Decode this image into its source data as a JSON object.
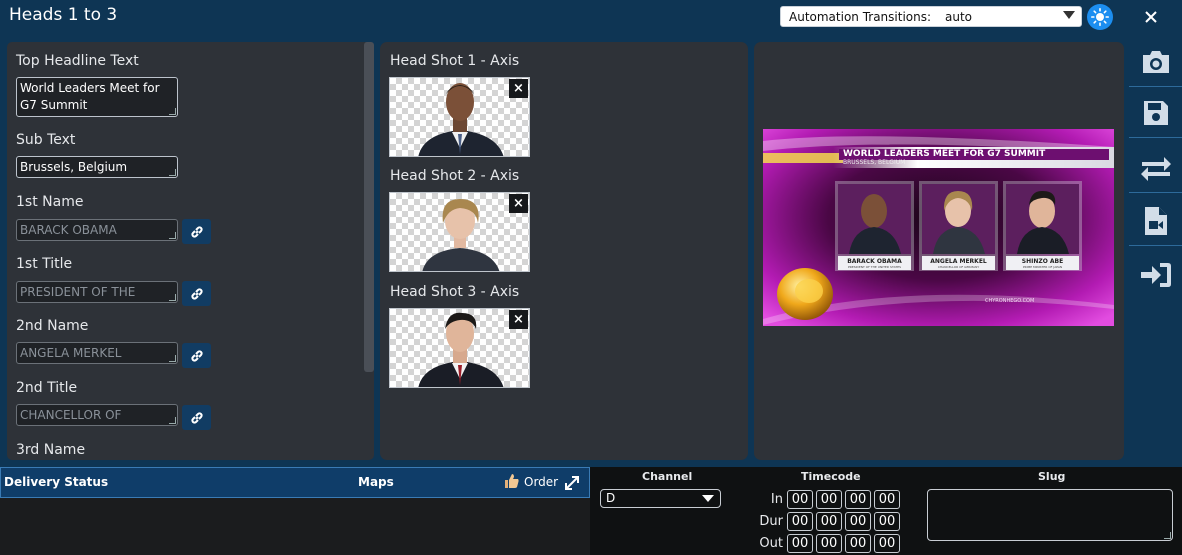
{
  "title": "Heads 1 to 3",
  "automation": {
    "label": "Automation Transitions:",
    "value": "auto"
  },
  "fields": [
    {
      "label": "Top Headline Text",
      "value": "World Leaders Meet for G7 Summit",
      "placeholder": ""
    },
    {
      "label": "Sub Text",
      "value": "Brussels, Belgium",
      "placeholder": ""
    },
    {
      "label": "1st Name",
      "value": "",
      "placeholder": "BARACK OBAMA"
    },
    {
      "label": "1st Title",
      "value": "",
      "placeholder": "PRESIDENT OF THE"
    },
    {
      "label": "2nd Name",
      "value": "",
      "placeholder": "ANGELA MERKEL"
    },
    {
      "label": "2nd Title",
      "value": "",
      "placeholder": "CHANCELLOR OF"
    },
    {
      "label": "3rd Name",
      "value": "",
      "placeholder": ""
    }
  ],
  "headshots": [
    {
      "label": "Head Shot 1 - Axis",
      "remove": "×"
    },
    {
      "label": "Head Shot 2 - Axis",
      "remove": "×"
    },
    {
      "label": "Head Shot 3 - Axis",
      "remove": "×"
    }
  ],
  "preview": {
    "headline": "WORLD LEADERS MEET FOR G7 SUMMIT",
    "sub": "BRUSSELS, BELGIUM",
    "people": [
      {
        "name": "BARACK OBAMA",
        "title": "PRESIDENT OF THE UNITED STATES"
      },
      {
        "name": "ANGELA MERKEL",
        "title": "CHANCELLOR OF GERMANY"
      },
      {
        "name": "SHINZO ABE",
        "title": "PRIME MINISTER OF JAPAN"
      }
    ],
    "watermark": "CHYRONHEGO.COM"
  },
  "sidebar_icons": [
    "camera-icon",
    "save-icon",
    "swap-icon",
    "video-file-icon",
    "sign-in-icon"
  ],
  "delivery": {
    "status_label": "Delivery Status",
    "maps_label": "Maps",
    "order_label": "Order"
  },
  "columns": {
    "channel": "Channel",
    "timecode": "Timecode",
    "slug": "Slug"
  },
  "channel_value": "D",
  "timecode": {
    "rows": [
      {
        "label": "In",
        "values": [
          "00",
          "00",
          "00",
          "00"
        ]
      },
      {
        "label": "Dur",
        "values": [
          "00",
          "00",
          "00",
          "00"
        ]
      },
      {
        "label": "Out",
        "values": [
          "00",
          "00",
          "00",
          "00"
        ]
      }
    ]
  },
  "colors": {
    "accent": "#1c8ef0",
    "panel": "#2e3238",
    "chrome": "#0e3554",
    "magenta": "#b31bb3"
  }
}
